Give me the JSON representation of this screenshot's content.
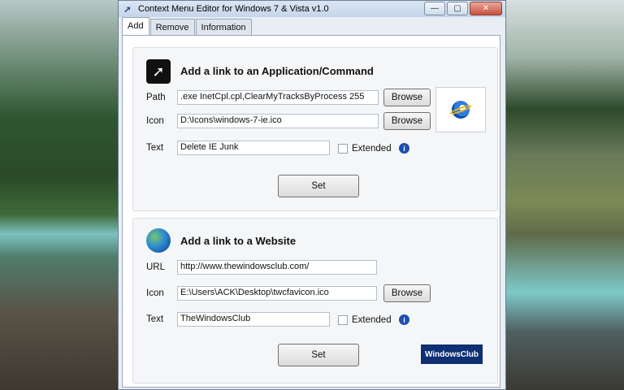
{
  "window": {
    "title": "Context Menu Editor for Windows 7 & Vista v1.0",
    "buttons": [
      "—",
      "▢",
      "✕"
    ]
  },
  "tabs": [
    {
      "label": "Add"
    },
    {
      "label": "Remove"
    },
    {
      "label": "Information"
    }
  ],
  "app_section": {
    "title": "Add a link to an Application/Command",
    "path_label": "Path",
    "path_value": ".exe InetCpl.cpl,ClearMyTracksByProcess 255",
    "icon_label": "Icon",
    "icon_value": "D:\\Icons\\windows-7-ie.ico",
    "text_label": "Text",
    "text_value": "Delete IE Junk",
    "browse_label": "Browse",
    "extended_label": "Extended",
    "set_label": "Set"
  },
  "web_section": {
    "title": "Add a link to a Website",
    "url_label": "URL",
    "url_value": "http://www.thewindowsclub.com/",
    "icon_label": "Icon",
    "icon_value": "E:\\Users\\ACK\\Desktop\\twcfavicon.ico",
    "text_label": "Text",
    "text_value": "TheWindowsClub",
    "browse_label": "Browse",
    "extended_label": "Extended",
    "set_label": "Set",
    "logo_text": "WindowsClub"
  }
}
